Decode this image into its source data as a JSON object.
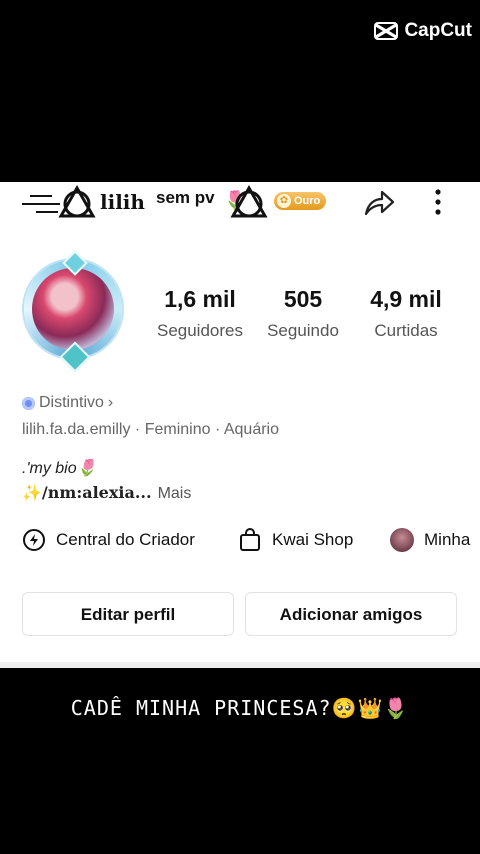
{
  "watermark": {
    "text": "CapCut"
  },
  "header": {
    "username": "lilih",
    "status_text": "sem pv",
    "rose_emoji": "🌷",
    "badge_label": "Ouro",
    "badge_icon": "coin-icon"
  },
  "profile": {
    "stats": [
      {
        "value": "1,6 mil",
        "label": "Seguidores"
      },
      {
        "value": "505",
        "label": "Seguindo"
      },
      {
        "value": "4,9 mil",
        "label": "Curtidas"
      }
    ],
    "distinctive_label": "Distintivo",
    "distinctive_chevron": "›",
    "meta": "lilih.fa.da.emilly  ·  Feminino  ·  Aquário",
    "bio_line1": ".'my bio🌷",
    "bio_line2_prefix": "✨",
    "bio_line2_handle": "/nm:alexia...",
    "bio_more": "Mais"
  },
  "shortcuts": [
    {
      "label": "Central do Criador",
      "icon": "lightning-pin-icon"
    },
    {
      "label": "Kwai Shop",
      "icon": "shopping-bag-icon"
    },
    {
      "label": "Minha",
      "icon": "avatar"
    }
  ],
  "actions": {
    "edit_label": "Editar perfil",
    "add_friends_label": "Adicionar amigos"
  },
  "caption": {
    "text": "CADÊ MINHA PRINCESA?🥺👑🌷"
  },
  "colors": {
    "badge_gold": "#e39a1d",
    "panel_bg": "#ffffff",
    "frame_bg": "#000000"
  }
}
